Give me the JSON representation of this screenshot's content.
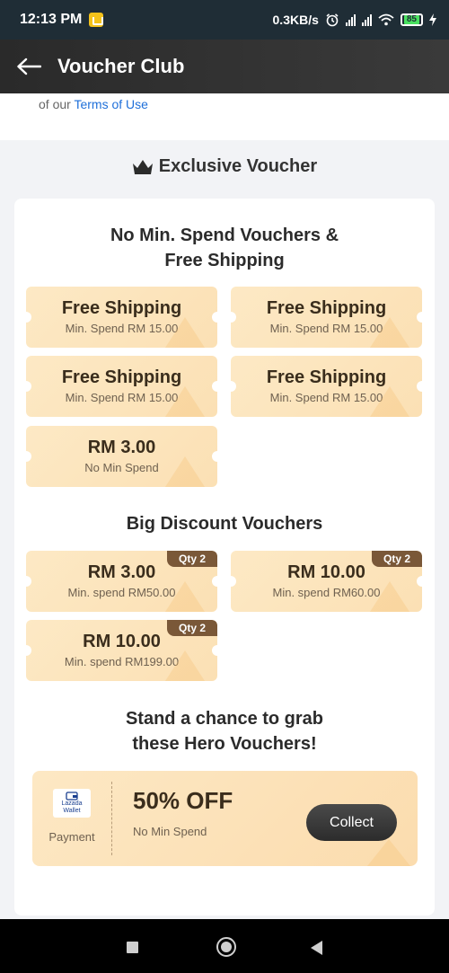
{
  "status_bar": {
    "time": "12:13 PM",
    "network_speed": "0.3KB/s",
    "battery": "85",
    "icons": [
      "notification-app-icon",
      "alarm-icon",
      "signal-icon",
      "signal-icon",
      "wifi-icon",
      "battery-icon",
      "charging-icon"
    ]
  },
  "header": {
    "title": "Voucher Club",
    "back_icon": "arrow-left-icon"
  },
  "terms": {
    "prefix": "of our",
    "link": "Terms of Use"
  },
  "exclusive": {
    "title": "Exclusive Voucher",
    "icon": "crown-icon"
  },
  "no_min_section": {
    "title_line1": "No Min. Spend Vouchers &",
    "title_line2": "Free Shipping",
    "vouchers": [
      {
        "title": "Free Shipping",
        "subtitle": "Min. Spend RM 15.00"
      },
      {
        "title": "Free Shipping",
        "subtitle": "Min. Spend RM 15.00"
      },
      {
        "title": "Free Shipping",
        "subtitle": "Min. Spend RM 15.00"
      },
      {
        "title": "Free Shipping",
        "subtitle": "Min. Spend RM 15.00"
      },
      {
        "title": "RM 3.00",
        "subtitle": "No Min Spend"
      }
    ]
  },
  "big_discount_section": {
    "title": "Big Discount Vouchers",
    "vouchers": [
      {
        "title": "RM 3.00",
        "subtitle": "Min. spend RM50.00",
        "badge": "Qty 2"
      },
      {
        "title": "RM 10.00",
        "subtitle": "Min. spend RM60.00",
        "badge": "Qty 2"
      },
      {
        "title": "RM 10.00",
        "subtitle": "Min. spend RM199.00",
        "badge": "Qty 2"
      }
    ]
  },
  "hero_section": {
    "title_line1": "Stand a chance to grab",
    "title_line2": "these Hero Vouchers!",
    "voucher": {
      "logo_line1": "Lazada",
      "logo_line2": "Wallet",
      "left_label": "Payment",
      "title": "50% OFF",
      "subtitle": "No Min Spend",
      "button": "Collect"
    }
  },
  "nav_bar": {
    "icons": [
      "recent-apps-icon",
      "home-icon",
      "back-icon"
    ]
  },
  "colors": {
    "voucher_bg": "#fde9c5",
    "badge": "#7a5838",
    "link": "#1e6fd9",
    "header": "#2a2a2a"
  }
}
